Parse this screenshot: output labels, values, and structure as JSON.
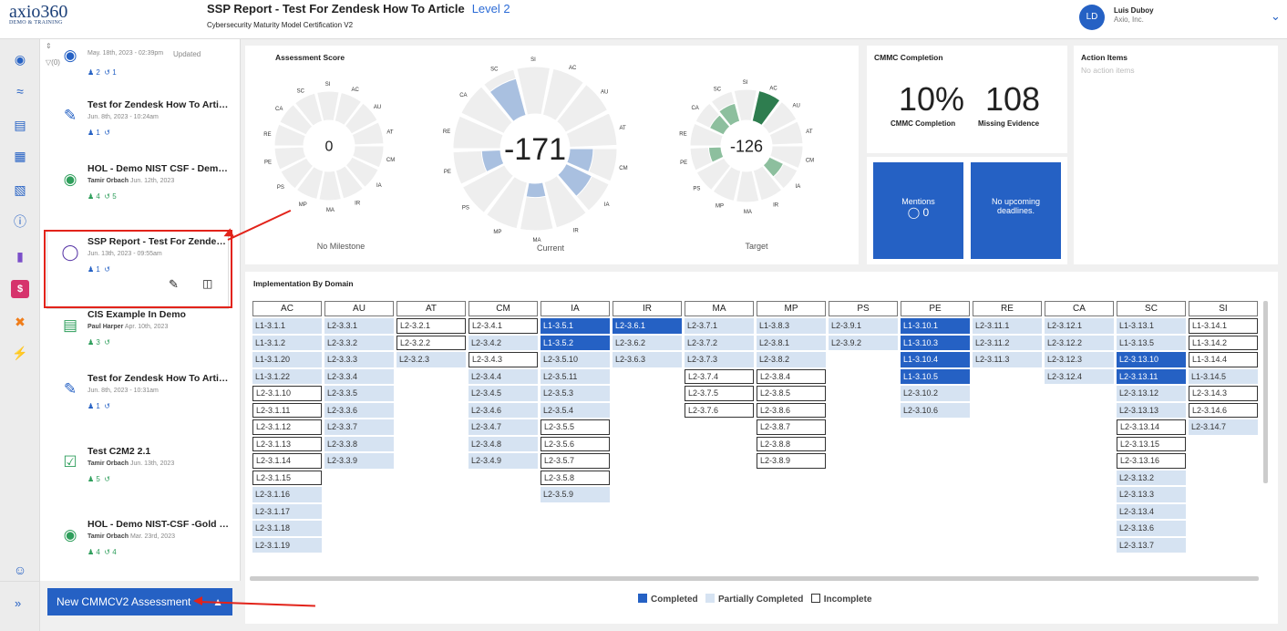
{
  "header": {
    "logo": "axio360",
    "logo_sub": "DEMO & TRAINING",
    "title": "SSP Report - Test For Zendesk How To Article",
    "level": "Level 2",
    "subtitle": "Cybersecurity Maturity Model Certification V2",
    "avatar": "LD",
    "user_name": "Luis Duboy",
    "user_org": "Axio, Inc."
  },
  "list": {
    "sort_label": "Updated",
    "filter_label": "(0)",
    "first_meta": "May. 18th, 2023 - 02:39pm",
    "first_people": "2",
    "first_hist": "1",
    "items": [
      {
        "title": "Test for Zendesk How To Article",
        "author": "",
        "date": "Jun. 8th, 2023 - 10:24am",
        "people": "1",
        "hist": "",
        "icon": "report-icon"
      },
      {
        "title": "HOL - Demo NIST CSF - Demo ...",
        "author": "Tamir Orbach",
        "date": "Jun. 12th, 2023",
        "people": "4",
        "hist": "5",
        "icon": "nist-icon"
      },
      {
        "title": "SSP Report - Test For Zendesk ...",
        "author": "",
        "date": "Jun. 13th, 2023 - 09:55am",
        "people": "1",
        "hist": "",
        "icon": "shield-icon"
      },
      {
        "title": "CIS Example In Demo",
        "author": "Paul Harper",
        "date": "Apr. 10th, 2023",
        "people": "3",
        "hist": "",
        "icon": "clipboard-icon"
      },
      {
        "title": "Test for Zendesk How To Article",
        "author": "",
        "date": "Jun. 8th, 2023 - 10:31am",
        "people": "1",
        "hist": "",
        "icon": "report-icon"
      },
      {
        "title": "Test C2M2 2.1",
        "author": "Tamir Orbach",
        "date": "Jun. 13th, 2023",
        "people": "5",
        "hist": "",
        "icon": "clipboard-check-icon"
      },
      {
        "title": "HOL - Demo NIST-CSF -Gold St...",
        "author": "Tamir Orbach",
        "date": "Mar. 23rd, 2023",
        "people": "4",
        "hist": "4",
        "icon": "nist-icon"
      }
    ],
    "new_button": "New CMMCV2 Assessment"
  },
  "score": {
    "title": "Assessment Score",
    "charts": [
      {
        "value": "0",
        "label": "No Milestone"
      },
      {
        "value": "-171",
        "label": "Current"
      },
      {
        "value": "-126",
        "label": "Target"
      }
    ],
    "domains": [
      "SI",
      "AC",
      "AU",
      "AT",
      "CM",
      "IA",
      "IR",
      "MA",
      "MP",
      "PS",
      "PE",
      "RE",
      "CA",
      "SC"
    ]
  },
  "completion": {
    "title": "CMMC Completion",
    "pct": "10%",
    "pct_label": "CMMC Completion",
    "missing": "108",
    "missing_label": "Missing Evidence"
  },
  "mentions": {
    "label": "Mentions",
    "count": "0",
    "deadlines": "No upcoming deadlines."
  },
  "actions": {
    "title": "Action Items",
    "empty": "No action items"
  },
  "impl": {
    "title": "Implementation By Domain",
    "headers": [
      "AC",
      "AU",
      "AT",
      "CM",
      "IA",
      "IR",
      "MA",
      "MP",
      "PS",
      "PE",
      "RE",
      "CA",
      "SC",
      "SI"
    ],
    "rows": [
      [
        "L1-3.1.1|p",
        "L2-3.3.1|p",
        "L2-3.2.1|i",
        "L2-3.4.1|i",
        "L1-3.5.1|c",
        "L2-3.6.1|c",
        "L2-3.7.1|p",
        "L1-3.8.3|p",
        "L2-3.9.1|p",
        "L1-3.10.1|c",
        "L2-3.11.1|p",
        "L2-3.12.1|p",
        "L1-3.13.1|p",
        "L1-3.14.1|i"
      ],
      [
        "L1-3.1.2|p",
        "L2-3.3.2|p",
        "L2-3.2.2|i",
        "L2-3.4.2|p",
        "L1-3.5.2|c",
        "L2-3.6.2|p",
        "L2-3.7.2|p",
        "L2-3.8.1|p",
        "L2-3.9.2|p",
        "L1-3.10.3|c",
        "L2-3.11.2|p",
        "L2-3.12.2|p",
        "L1-3.13.5|p",
        "L1-3.14.2|i"
      ],
      [
        "L1-3.1.20|p",
        "L2-3.3.3|p",
        "L2-3.2.3|p",
        "L2-3.4.3|i",
        "L2-3.5.10|p",
        "L2-3.6.3|p",
        "L2-3.7.3|p",
        "L2-3.8.2|p",
        "|e",
        "L1-3.10.4|c",
        "L2-3.11.3|p",
        "L2-3.12.3|p",
        "L2-3.13.10|c",
        "L1-3.14.4|i"
      ],
      [
        "L1-3.1.22|p",
        "L2-3.3.4|p",
        "|e",
        "L2-3.4.4|p",
        "L2-3.5.11|p",
        "|e",
        "L2-3.7.4|i",
        "L2-3.8.4|i",
        "|e",
        "L1-3.10.5|c",
        "|e",
        "L2-3.12.4|p",
        "L2-3.13.11|c",
        "L1-3.14.5|p"
      ],
      [
        "L2-3.1.10|i",
        "L2-3.3.5|p",
        "|e",
        "L2-3.4.5|p",
        "L2-3.5.3|p",
        "|e",
        "L2-3.7.5|i",
        "L2-3.8.5|i",
        "|e",
        "L2-3.10.2|p",
        "|e",
        "|e",
        "L2-3.13.12|p",
        "L2-3.14.3|i"
      ],
      [
        "L2-3.1.11|i",
        "L2-3.3.6|p",
        "|e",
        "L2-3.4.6|p",
        "L2-3.5.4|p",
        "|e",
        "L2-3.7.6|i",
        "L2-3.8.6|i",
        "|e",
        "L2-3.10.6|p",
        "|e",
        "|e",
        "L2-3.13.13|p",
        "L2-3.14.6|i"
      ],
      [
        "L2-3.1.12|i",
        "L2-3.3.7|p",
        "|e",
        "L2-3.4.7|p",
        "L2-3.5.5|i",
        "|e",
        "|e",
        "L2-3.8.7|i",
        "|e",
        "|e",
        "|e",
        "|e",
        "L2-3.13.14|i",
        "L2-3.14.7|p"
      ],
      [
        "L2-3.1.13|i",
        "L2-3.3.8|p",
        "|e",
        "L2-3.4.8|p",
        "L2-3.5.6|i",
        "|e",
        "|e",
        "L2-3.8.8|i",
        "|e",
        "|e",
        "|e",
        "|e",
        "L2-3.13.15|i",
        "|e"
      ],
      [
        "L2-3.1.14|i",
        "L2-3.3.9|p",
        "|e",
        "L2-3.4.9|p",
        "L2-3.5.7|i",
        "|e",
        "|e",
        "L2-3.8.9|i",
        "|e",
        "|e",
        "|e",
        "|e",
        "L2-3.13.16|i",
        "|e"
      ],
      [
        "L2-3.1.15|i",
        "|e",
        "|e",
        "|e",
        "L2-3.5.8|i",
        "|e",
        "|e",
        "|e",
        "|e",
        "|e",
        "|e",
        "|e",
        "L2-3.13.2|p",
        "|e"
      ],
      [
        "L2-3.1.16|p",
        "|e",
        "|e",
        "|e",
        "L2-3.5.9|p",
        "|e",
        "|e",
        "|e",
        "|e",
        "|e",
        "|e",
        "|e",
        "L2-3.13.3|p",
        "|e"
      ],
      [
        "L2-3.1.17|p",
        "|e",
        "|e",
        "|e",
        "|e",
        "|e",
        "|e",
        "|e",
        "|e",
        "|e",
        "|e",
        "|e",
        "L2-3.13.4|p",
        "|e"
      ],
      [
        "L2-3.1.18|p",
        "|e",
        "|e",
        "|e",
        "|e",
        "|e",
        "|e",
        "|e",
        "|e",
        "|e",
        "|e",
        "|e",
        "L2-3.13.6|p",
        "|e"
      ],
      [
        "L2-3.1.19|p",
        "|e",
        "|e",
        "|e",
        "|e",
        "|e",
        "|e",
        "|e",
        "|e",
        "|e",
        "|e",
        "|e",
        "L2-3.13.7|p",
        "|e"
      ]
    ],
    "legend": {
      "completed": "Completed",
      "partial": "Partially Completed",
      "incomplete": "Incomplete"
    }
  },
  "colors": {
    "accent": "#2561c4",
    "partial": "#d6e3f2",
    "green": "#2e7d4f",
    "annotation": "#e2231a"
  }
}
